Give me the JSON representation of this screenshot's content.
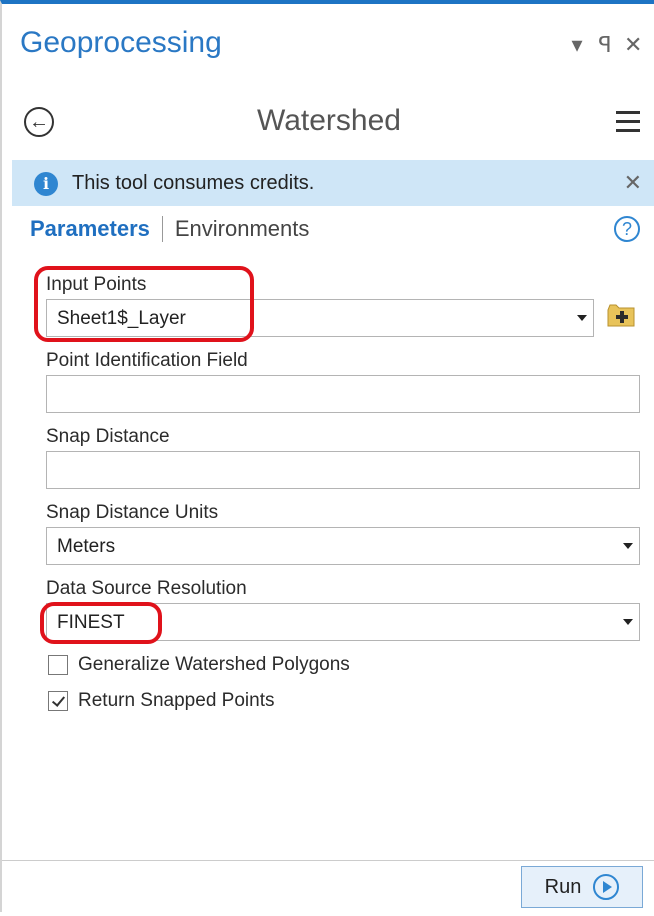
{
  "panel": {
    "title": "Geoprocessing",
    "controls": {
      "pin_glyph": "▾",
      "autohide_glyph": "ꟼ",
      "close_glyph": "✕"
    }
  },
  "tool": {
    "name": "Watershed",
    "back_glyph": "←"
  },
  "banner": {
    "message": "This tool consumes credits.",
    "info_glyph": "i",
    "close_glyph": "✕",
    "background": "#cfe6f7"
  },
  "tabs": {
    "active": "Parameters",
    "other": "Environments",
    "help_glyph": "?"
  },
  "params": {
    "input_points": {
      "label": "Input Points",
      "value": "Sheet1$_Layer"
    },
    "point_id_field": {
      "label": "Point Identification Field",
      "value": ""
    },
    "snap_distance": {
      "label": "Snap Distance",
      "value": ""
    },
    "snap_units": {
      "label": "Snap Distance Units",
      "value": "Meters"
    },
    "resolution": {
      "label": "Data Source Resolution",
      "value": "FINEST"
    },
    "generalize": {
      "label": "Generalize Watershed Polygons",
      "checked": false
    },
    "return_snapped": {
      "label": "Return Snapped Points",
      "checked": true
    }
  },
  "footer": {
    "run_label": "Run"
  },
  "colors": {
    "accent": "#1f6fc0",
    "highlight": "#e0121b",
    "button_bg": "#e6f0fa"
  }
}
